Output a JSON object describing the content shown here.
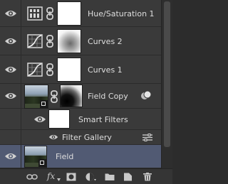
{
  "panel": {
    "layers": [
      {
        "name": "Hue/Saturation 1",
        "kind": "hue-saturation-adjustment"
      },
      {
        "name": "Curves 2",
        "kind": "curves-adjustment"
      },
      {
        "name": "Curves 1",
        "kind": "curves-adjustment"
      },
      {
        "name": "Field Copy",
        "kind": "smart-object"
      },
      {
        "name": "Smart Filters",
        "kind": "smart-filters-mask"
      },
      {
        "name": "Filter Gallery",
        "kind": "filter-entry"
      },
      {
        "name": "Field",
        "kind": "smart-object",
        "selected": true
      }
    ],
    "footer_icons": [
      "link-icon",
      "fx-icon",
      "add-mask-icon",
      "adjustment-icon",
      "group-folder-icon",
      "new-layer-icon",
      "trash-icon"
    ],
    "footer_fx_label": "fx",
    "colors": {
      "panel_bg": "#3a3a3a",
      "selected_bg": "#515a73",
      "text": "#dedede"
    }
  }
}
